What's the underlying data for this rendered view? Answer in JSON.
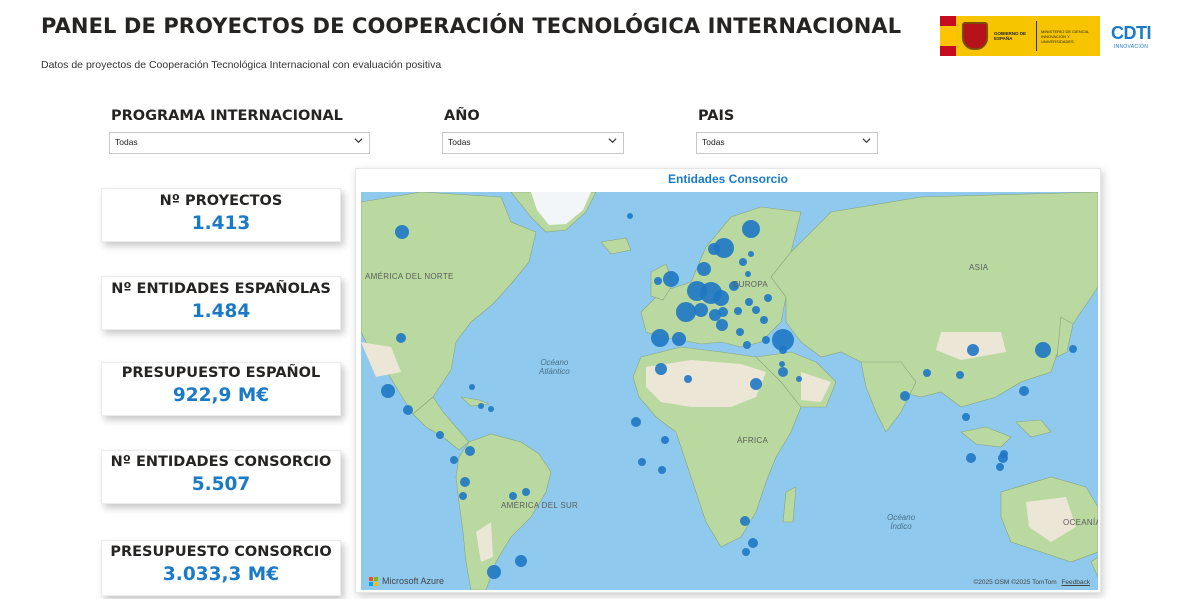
{
  "header": {
    "title": "PANEL DE PROYECTOS DE COOPERACIÓN TECNOLÓGICA INTERNACIONAL",
    "subtitle": "Datos de proyectos de Cooperación Tecnológica Internacional con evaluación positiva"
  },
  "logos": {
    "gov_text": "GOBIERNO DE ESPAÑA",
    "ministry_text": "MINISTERIO DE CIENCIA, INNOVACIÓN Y UNIVERSIDADES",
    "cdti_mark": "CDTI",
    "cdti_sub": "INNOVACIÓN"
  },
  "filters": [
    {
      "label": "PROGRAMA INTERNACIONAL",
      "value": "Todas"
    },
    {
      "label": "AÑO",
      "value": "Todas"
    },
    {
      "label": "PAIS",
      "value": "Todas"
    }
  ],
  "kpis": [
    {
      "label": "Nº PROYECTOS",
      "value": "1.413"
    },
    {
      "label": "Nº ENTIDADES ESPAÑOLAS",
      "value": "1.484"
    },
    {
      "label": "PRESUPUESTO ESPAÑOL",
      "value": "922,9 M€"
    },
    {
      "label": "Nº ENTIDADES CONSORCIO",
      "value": "5.507"
    },
    {
      "label": "PRESUPUESTO CONSORCIO",
      "value": "3.033,3 M€"
    }
  ],
  "map": {
    "title": "Entidades Consorcio",
    "labels": {
      "north_america": "AMÉRICA DEL NORTE",
      "europe": "EUROPA",
      "asia": "ASIA",
      "africa": "ÁFRICA",
      "south_america": "AMÉRICA DEL SUR",
      "oceania": "OCEANÍA",
      "atlantic": "Océano\nAtlántico",
      "indian": "Océano\nÍndico"
    },
    "provider": "Microsoft Azure",
    "attribution": "©2025 OSM ©2025 TomTom",
    "feedback": "Feedback",
    "colors": {
      "bubble": "#1f77c4",
      "water": "#8fcaee",
      "land": "#b9d9a1",
      "desert": "#ece6d6"
    }
  }
}
